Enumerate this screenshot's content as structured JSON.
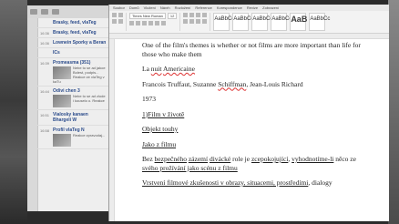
{
  "chat": {
    "items": [
      {
        "time": "",
        "name": "Brasky, feed, vlaTeg",
        "text": ""
      },
      {
        "time": "16:36",
        "name": "Brasky, feed, vlaTeg",
        "text": ""
      },
      {
        "time": "16:36",
        "name": "Lownein Sporky a Beran",
        "text": ""
      },
      {
        "time": "",
        "name": "ICs",
        "text": ""
      },
      {
        "time": "16:39",
        "name": "Promeasma (351)",
        "text": "Nebe to se ad jakoe Bolest, podpis... Reakce ze vlaTeg v kaTu"
      },
      {
        "time": "16:44",
        "name": "Odivi chen 3",
        "text": "Nebe to se ad zlode i kouselo o. Reakce"
      },
      {
        "time": "16:51",
        "name": "Vialosky kanaen Bhargeli W",
        "text": ""
      },
      {
        "time": "16:58",
        "name": "Profil vlaTeg N",
        "text": "Reakce zpravodaj..."
      }
    ]
  },
  "word": {
    "tabs": [
      "Soubor",
      "Domů",
      "Vložení",
      "Návrh",
      "Rozložení",
      "Reference",
      "Korespondence",
      "Revize",
      "Zobrazení"
    ],
    "font_name": "Times New Roman",
    "font_size": "12",
    "style_samples": [
      "AaBbCcDd",
      "AaBbCcDd",
      "AaBbCc",
      "AaBbCcI",
      "AaB",
      "AaBbCc"
    ]
  },
  "document": {
    "p1": "One of the film's themes is whether or not films are more important than life for those who make them",
    "p2_a": "La ",
    "p2_b": "nuit",
    "p2_c": " ",
    "p2_d": "Americaine",
    "p3_a": "Francois Truffaut, Suzanne ",
    "p3_b": "Schiffman",
    "p3_c": ", Jean-Louis Richard",
    "p4": "1973",
    "p5": "1)Film v životě",
    "p6": "Objekt touhy",
    "p7": "Jako z filmu",
    "p8_a": "Bez ",
    "p8_b": "bezpečného",
    "p8_c": " ",
    "p8_d": "zázemí",
    "p8_e": " ",
    "p8_f": "divácké",
    "p8_g": " role je ",
    "p8_h": "zcepokojující",
    "p8_i": ", ",
    "p8_j": "vyhodnotíme-li",
    "p8_k": " něco ze",
    "p8_l": "svého prožívání jako scénu z filmu",
    "p9_a": "Vrstvení filmové zkušenosti v obrazy, situacemi, prostředími",
    "p9_b": ", dialogy"
  }
}
